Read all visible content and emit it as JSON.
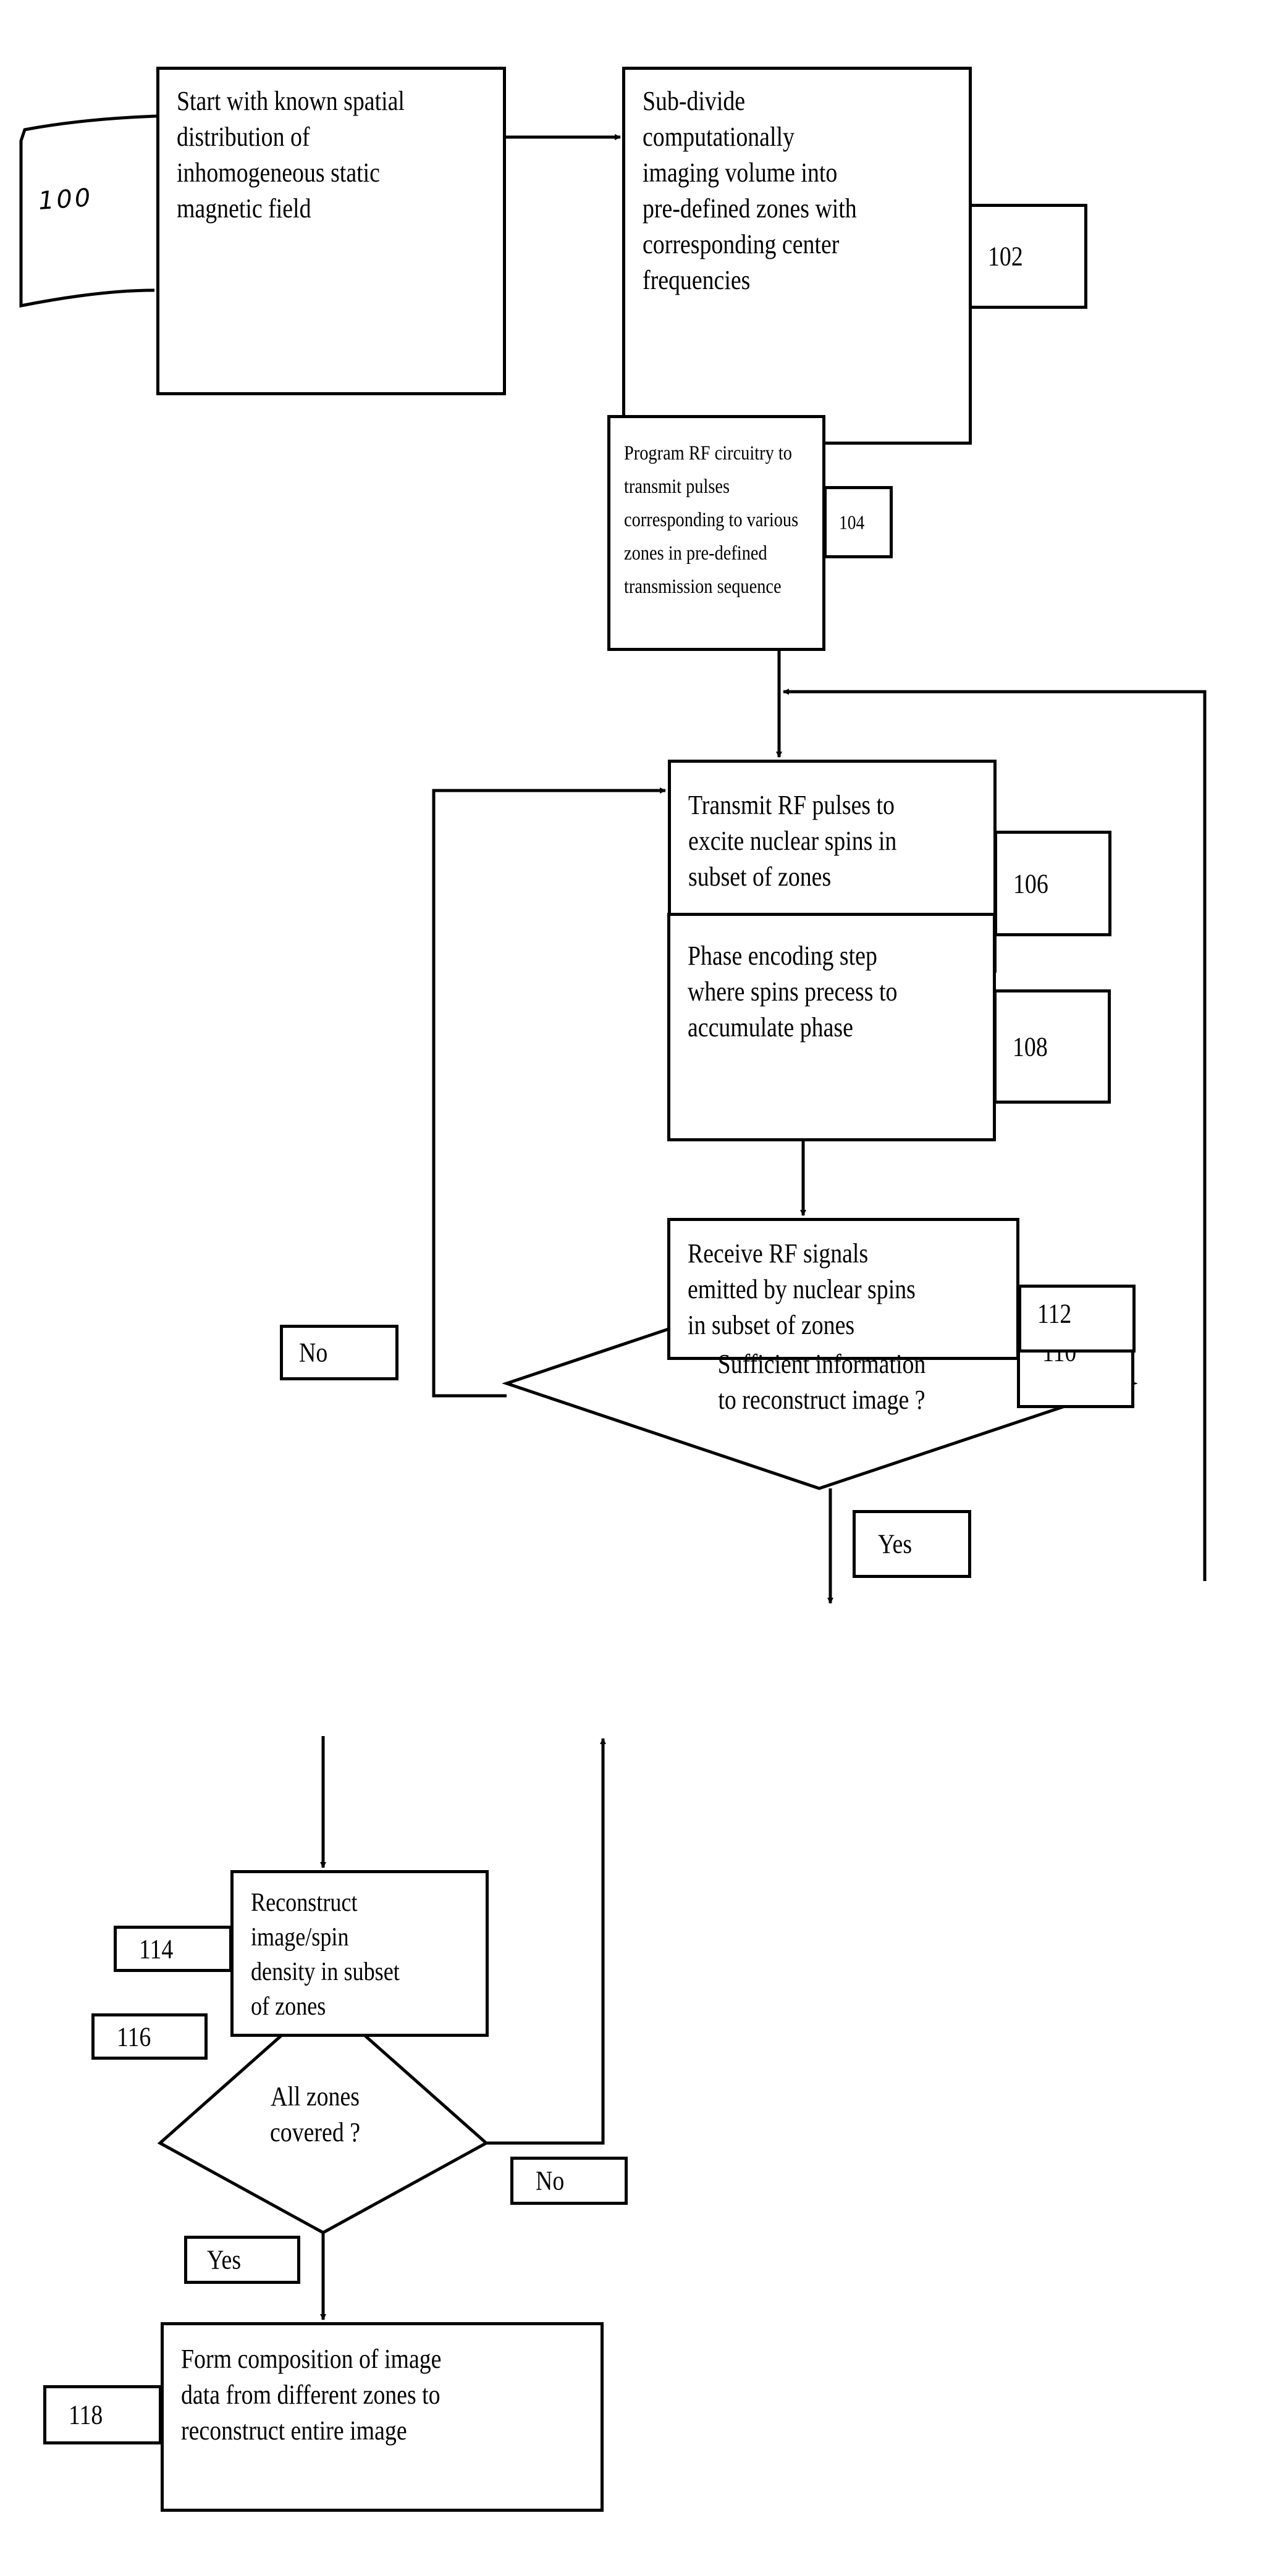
{
  "diagram": {
    "type": "flowchart",
    "steps": [
      {
        "ref": "100",
        "kind": "process",
        "text": "Start with known spatial distribution of inhomogeneous static magnetic field",
        "lines": [
          "Start with known spatial",
          "distribution of",
          "inhomogeneous static",
          "magnetic field"
        ]
      },
      {
        "ref": "102",
        "kind": "process",
        "text": "Sub-divide computationally imaging volume into pre-defined zones with corresponding center frequencies",
        "lines": [
          "Sub-divide",
          "computationally",
          "imaging volume into",
          "pre-defined zones with",
          "corresponding center",
          "frequencies"
        ]
      },
      {
        "ref": "104",
        "kind": "process",
        "text": "Program RF circuitry to transmit pulses corresponding to various zones in pre-defined transmission sequence",
        "lines": [
          "Program RF circuitry to",
          "transmit pulses",
          "corresponding to various",
          "zones in pre-defined",
          "transmission sequence"
        ]
      },
      {
        "ref": "106",
        "kind": "process",
        "text": "Transmit RF pulses to excite nuclear spins in subset of zones",
        "lines": [
          "Transmit RF pulses to",
          "excite nuclear spins in",
          "subset of zones"
        ]
      },
      {
        "ref": "108",
        "kind": "process",
        "text": "Phase encoding step where spins precess to accumulate phase",
        "lines": [
          "Phase encoding step",
          "where spins precess to",
          "accumulate phase"
        ]
      },
      {
        "ref": "110",
        "kind": "process",
        "text": "Receive RF signals emitted by nuclear spins in subset of zones",
        "lines": [
          "Receive RF signals",
          "emitted by nuclear spins",
          "in subset of zones"
        ]
      },
      {
        "ref": "112",
        "kind": "decision",
        "text": "Sufficient information to reconstruct image ?",
        "lines": [
          "Sufficient information",
          "to reconstruct image ?"
        ]
      },
      {
        "ref": "114",
        "kind": "process",
        "text": "Reconstruct image/spin density in subset of zones",
        "lines": [
          "Reconstruct",
          "image/spin",
          "density in subset",
          "of zones"
        ]
      },
      {
        "ref": "116",
        "kind": "decision",
        "text": "All zones covered ?",
        "lines": [
          "All zones",
          "covered ?"
        ]
      },
      {
        "ref": "118",
        "kind": "process",
        "text": "Form composition of image data from different zones to reconstruct entire image",
        "lines": [
          "Form composition of image",
          "data from different zones to",
          "reconstruct entire image"
        ]
      }
    ],
    "branch_labels": {
      "d112_no": "No",
      "d112_yes": "Yes",
      "d116_no": "No",
      "d116_yes": "Yes"
    },
    "edges": [
      {
        "from": "100",
        "to": "102"
      },
      {
        "from": "102",
        "to": "104"
      },
      {
        "from": "104",
        "to": "106"
      },
      {
        "from": "106",
        "to": "108"
      },
      {
        "from": "108",
        "to": "110"
      },
      {
        "from": "110",
        "to": "112"
      },
      {
        "from": "112",
        "to": "106",
        "label": "No"
      },
      {
        "from": "112",
        "to": "114",
        "label": "Yes"
      },
      {
        "from": "114",
        "to": "116"
      },
      {
        "from": "116",
        "to": "106",
        "label": "No"
      },
      {
        "from": "116",
        "to": "118",
        "label": "Yes"
      }
    ]
  }
}
